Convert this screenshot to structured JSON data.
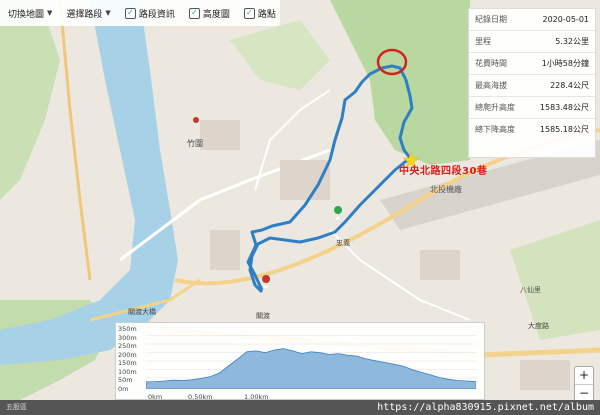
{
  "toolbar": {
    "basemap_label": "切換地圖",
    "route_label": "選擇路段",
    "checkboxes": [
      {
        "label": "路段資訊",
        "checked": true
      },
      {
        "label": "高度圖",
        "checked": true
      },
      {
        "label": "路點",
        "checked": true
      }
    ]
  },
  "stats": [
    {
      "label": "紀錄日期",
      "value": "2020-05-01"
    },
    {
      "label": "里程",
      "value": "5.32公里"
    },
    {
      "label": "花費時間",
      "value": "1小時58分鐘"
    },
    {
      "label": "最高海拔",
      "value": "228.4公尺"
    },
    {
      "label": "總爬升高度",
      "value": "1583.48公尺"
    },
    {
      "label": "總下降高度",
      "value": "1585.18公尺"
    }
  ],
  "callout_text": "中央北路四段30巷",
  "elevation": {
    "y_labels": [
      "350m",
      "300m",
      "250m",
      "200m",
      "150m",
      "100m",
      "50m",
      "0m"
    ],
    "x_labels": [
      "0km",
      "0.50km",
      "1.00km"
    ],
    "profile": [
      40,
      42,
      45,
      50,
      48,
      52,
      60,
      70,
      90,
      130,
      170,
      210,
      215,
      205,
      220,
      228,
      215,
      200,
      210,
      205,
      195,
      200,
      190,
      185,
      170,
      160,
      150,
      140,
      130,
      110,
      95,
      80,
      65,
      55,
      48,
      45,
      42
    ]
  },
  "map_labels": {
    "zhuwei": "竹圍",
    "zhongyi": "忠義",
    "guandu": "關渡",
    "beitou_depot": "北投機廠",
    "guandu_bridge": "關渡大橋",
    "dadu_road": "大度路",
    "bali": "八仙里"
  },
  "zoom": {
    "plus": "+",
    "minus": "−"
  },
  "watermark": "https://alpha830915.pixnet.net/album",
  "footer_left": "五股區"
}
